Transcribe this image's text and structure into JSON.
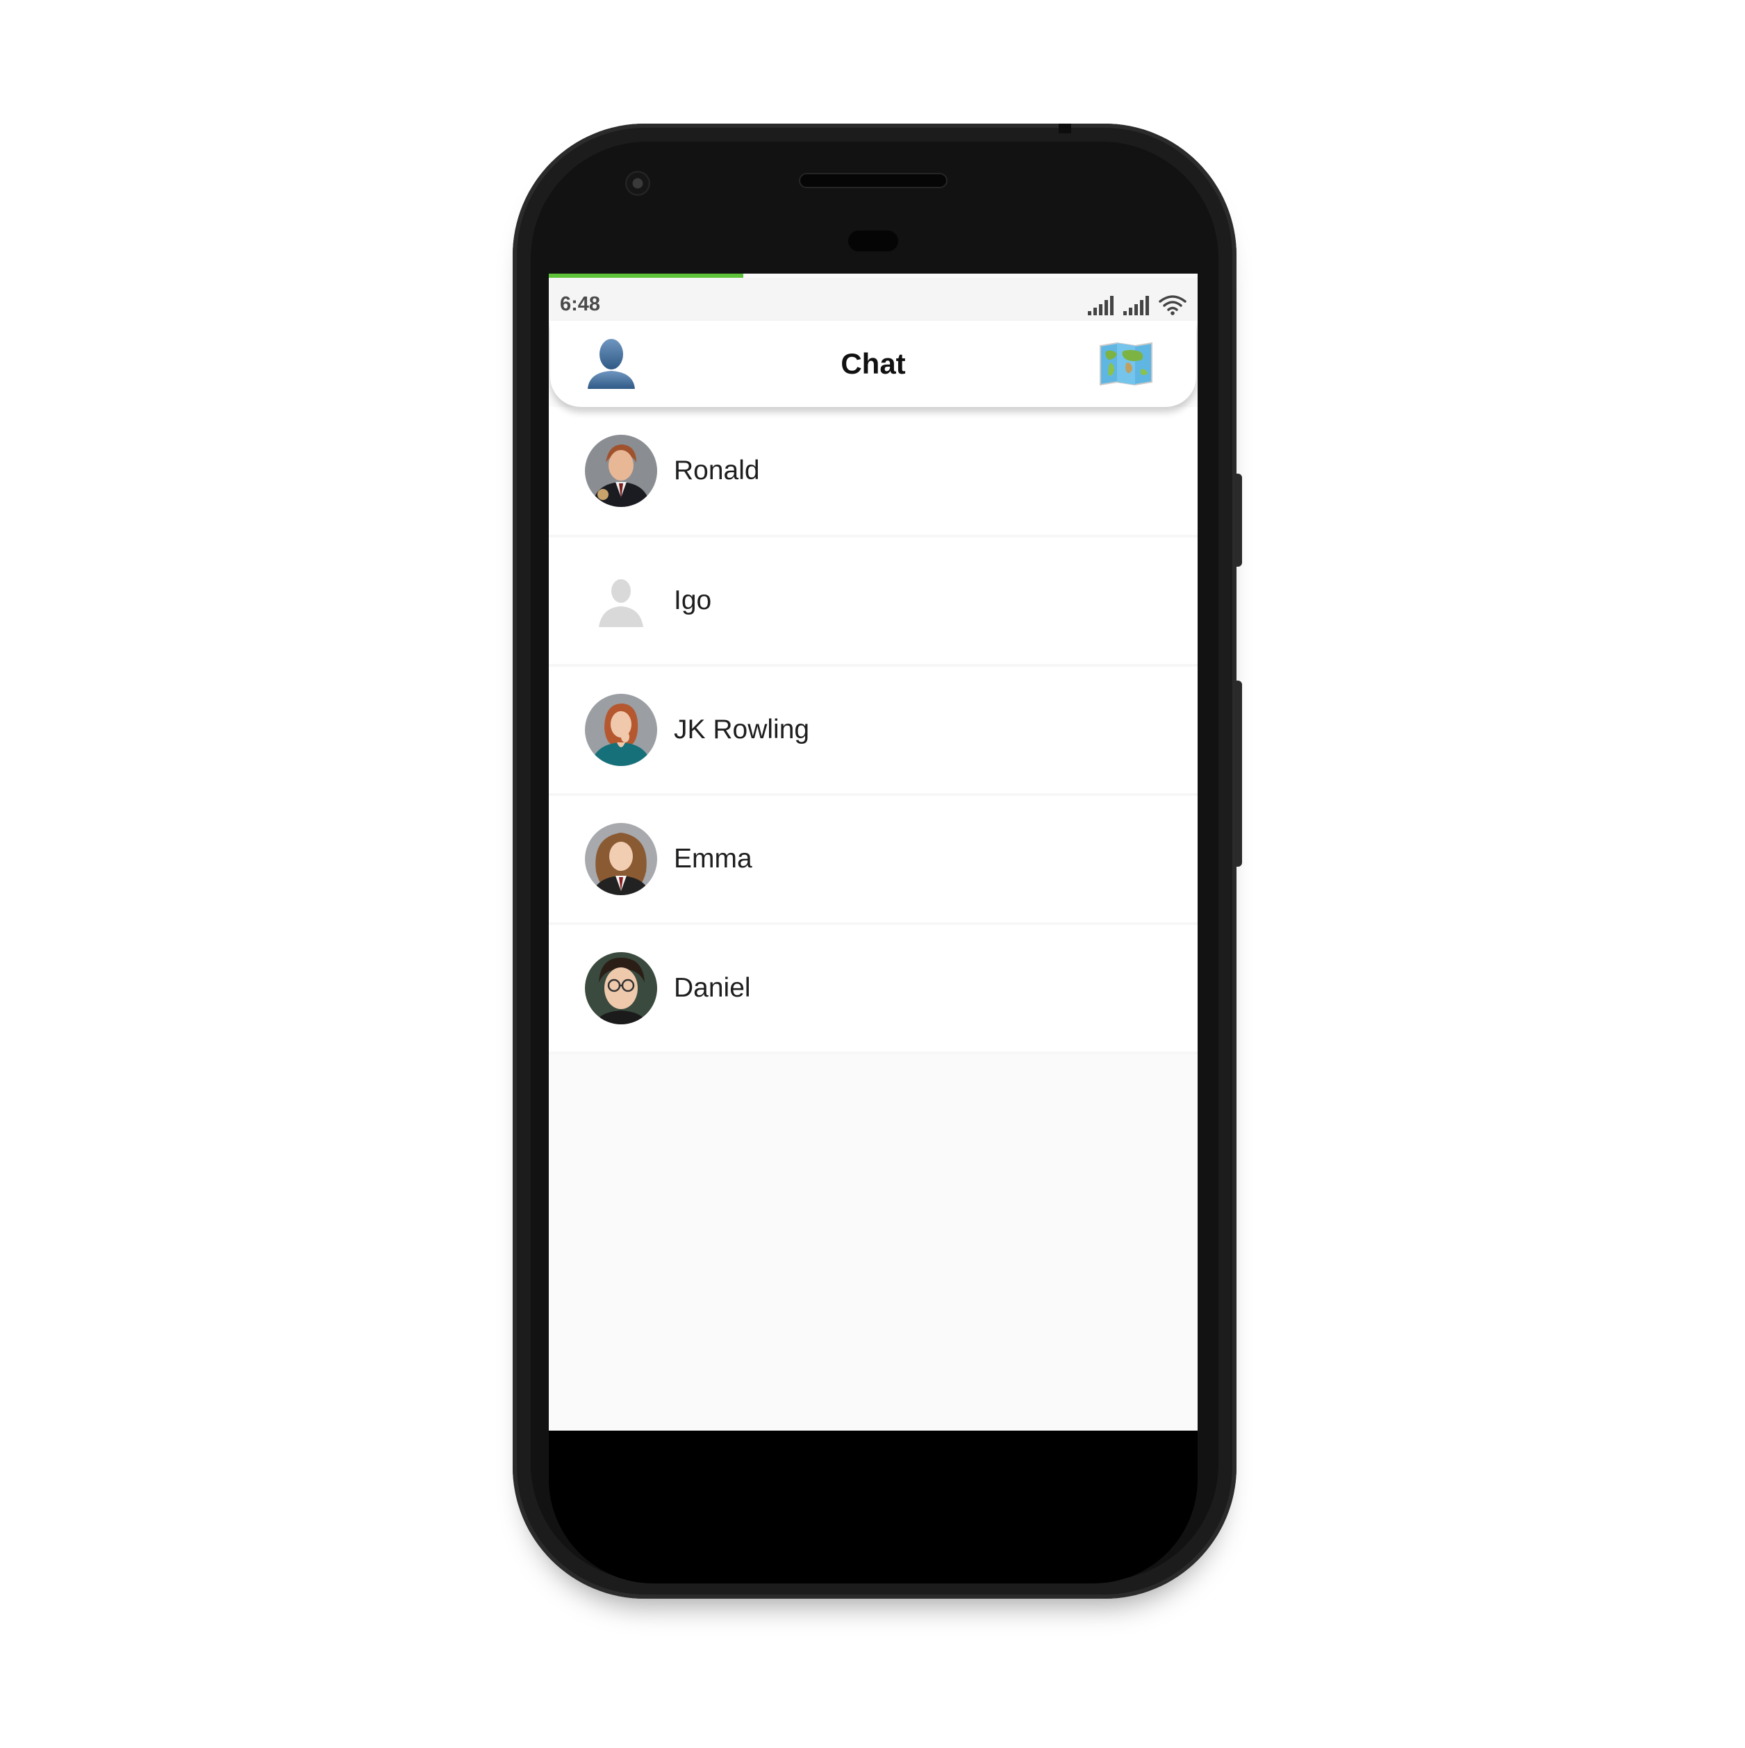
{
  "status_bar": {
    "time": "6:48"
  },
  "header": {
    "title": "Chat",
    "left_icon": "profile-icon",
    "right_icon": "world-map-icon"
  },
  "contacts": [
    {
      "name": "Ronald",
      "avatar": "photo"
    },
    {
      "name": "Igo",
      "avatar": "placeholder"
    },
    {
      "name": "JK Rowling",
      "avatar": "photo"
    },
    {
      "name": "Emma",
      "avatar": "photo"
    },
    {
      "name": "Daniel",
      "avatar": "photo"
    }
  ],
  "colors": {
    "loading_bar": "#5fc33a",
    "background": "#fafafa"
  }
}
